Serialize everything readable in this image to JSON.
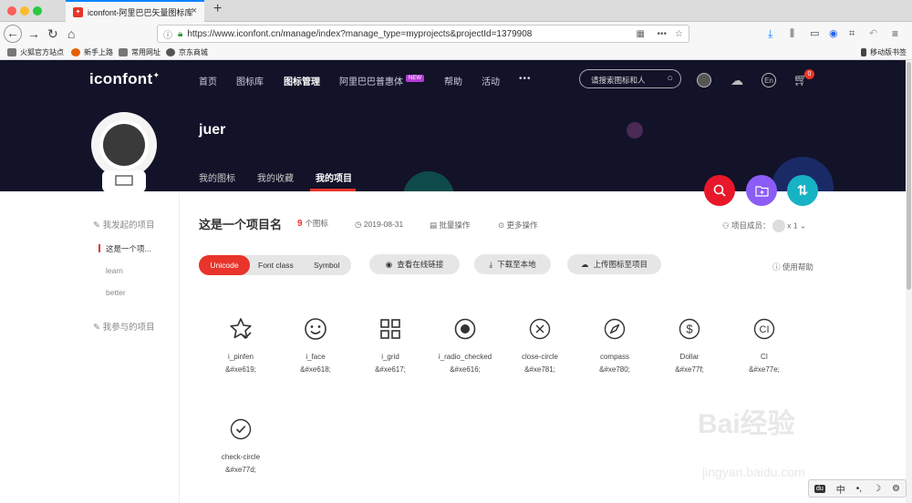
{
  "browser": {
    "tab_title": "iconfont-阿里巴巴矢量图标库",
    "url": "https://www.iconfont.cn/manage/index?manage_type=myprojects&projectId=1379908",
    "bookmarks": [
      "火狐官方站点",
      "新手上路",
      "常用网址",
      "京东商城"
    ],
    "mobile_bookmarks": "移动版书签"
  },
  "site": {
    "logo": "iconfont",
    "nav": [
      "首页",
      "图标库",
      "图标管理",
      "阿里巴巴普惠体",
      "帮助",
      "活动",
      "•••"
    ],
    "new_badge": "NEW",
    "search_placeholder": "请搜索图标和人",
    "lang_button": "En",
    "cart_count": "0"
  },
  "profile": {
    "username": "juer",
    "tabs": [
      "我的图标",
      "我的收藏",
      "我的项目"
    ]
  },
  "sidebar": {
    "my_projects_heading": "我发起的项目",
    "projects": [
      "这是一个项...",
      "learn",
      "better"
    ],
    "joined_heading": "我参与的项目"
  },
  "project": {
    "name": "这是一个项目名",
    "icon_count": "9",
    "icon_count_unit": "个图标",
    "date": "2019-08-31",
    "batch_action": "批量操作",
    "more_action": "更多操作",
    "members_label": "项目成员：",
    "members_count": "x 1",
    "help": "使用帮助"
  },
  "toolbar": {
    "formats": [
      "Unicode",
      "Font class",
      "Symbol"
    ],
    "view_online": "查看在线链接",
    "download": "下载至本地",
    "upload": "上传图标至项目"
  },
  "icons": [
    {
      "name": "i_pinfen",
      "code": "&#xe619;",
      "icon": "star-check-icon"
    },
    {
      "name": "i_face",
      "code": "&#xe618;",
      "icon": "smiley-face-icon"
    },
    {
      "name": "i_grid",
      "code": "&#xe617;",
      "icon": "grid-icon"
    },
    {
      "name": "i_radio_checked",
      "code": "&#xe616;",
      "icon": "radio-checked-icon"
    },
    {
      "name": "close-circle",
      "code": "&#xe781;",
      "icon": "close-circle-icon"
    },
    {
      "name": "compass",
      "code": "&#xe780;",
      "icon": "compass-icon"
    },
    {
      "name": "Dollar",
      "code": "&#xe77f;",
      "icon": "dollar-icon"
    },
    {
      "name": "CI",
      "code": "&#xe77e;",
      "icon": "ci-icon"
    },
    {
      "name": "check-circle",
      "code": "&#xe77d;",
      "icon": "check-circle-icon"
    }
  ],
  "ime_bar": [
    "中",
    "•,",
    "☽",
    "⚙"
  ],
  "watermark": "Bai经验",
  "watermark_sub": "jingyan.baidu.com",
  "colors": {
    "accent": "#e8342a",
    "header_bg": "#121229",
    "fab_search": "#e8182a",
    "fab_folder": "#8b5cf6",
    "fab_sort": "#17b3c4"
  }
}
